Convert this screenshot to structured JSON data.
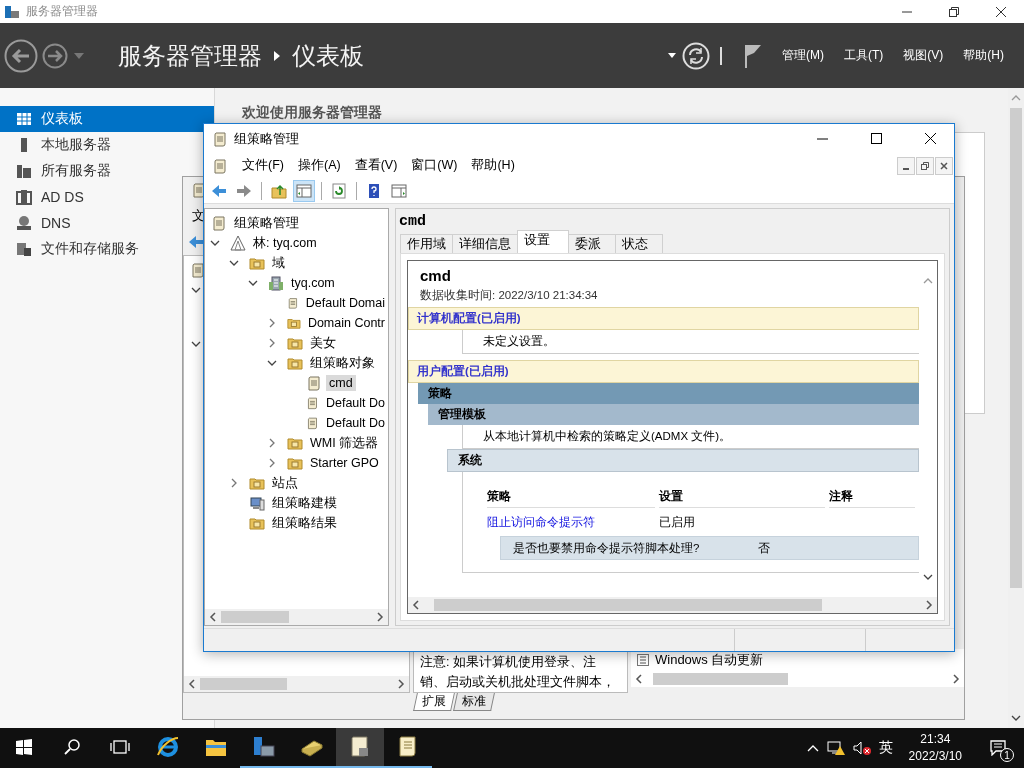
{
  "server_manager": {
    "title": "服务器管理器",
    "breadcrumb": {
      "app": "服务器管理器",
      "page": "仪表板"
    },
    "menu": [
      "管理(M)",
      "工具(T)",
      "视图(V)",
      "帮助(H)"
    ],
    "nav": [
      {
        "label": "仪表板",
        "kind": "dashboard",
        "selected": true
      },
      {
        "label": "本地服务器",
        "kind": "server",
        "selected": false
      },
      {
        "label": "所有服务器",
        "kind": "servers",
        "selected": false
      },
      {
        "label": "AD DS",
        "kind": "adds",
        "selected": false
      },
      {
        "label": "DNS",
        "kind": "dns",
        "selected": false
      },
      {
        "label": "文件和存储服务",
        "kind": "storage",
        "selected": false
      }
    ],
    "welcome": "欢迎使用服务器管理器"
  },
  "editor_window_behind": {
    "menu_visible": "文",
    "note_lines": [
      "注意: 如果计算机使用登录、注",
      "销、启动或关机批处理文件脚本，"
    ],
    "result_item": "Windows 自动更新",
    "tabs": [
      {
        "label": "扩展",
        "selected": true
      },
      {
        "label": "标准",
        "selected": false
      }
    ]
  },
  "gpm_window": {
    "title": "组策略管理",
    "menu": [
      "文件(F)",
      "操作(A)",
      "查看(V)",
      "窗口(W)",
      "帮助(H)"
    ],
    "tree": {
      "label": "组策略管理",
      "kind": "gpm",
      "selected": false,
      "children": [
        {
          "label": "林: tyq.com",
          "kind": "forest",
          "selected": false,
          "expanded": true,
          "children": [
            {
              "label": "域",
              "kind": "domains",
              "selected": false,
              "expanded": true,
              "children": [
                {
                  "label": "tyq.com",
                  "kind": "domain",
                  "selected": false,
                  "expanded": true,
                  "children": [
                    {
                      "label": "Default Domai",
                      "kind": "gpo-link",
                      "selected": false
                    },
                    {
                      "label": "Domain Contr",
                      "kind": "ou",
                      "selected": false,
                      "expanded": false
                    },
                    {
                      "label": "美女",
                      "kind": "ou",
                      "selected": false,
                      "expanded": false
                    },
                    {
                      "label": "组策略对象",
                      "kind": "gpo-folder",
                      "selected": false,
                      "expanded": true,
                      "children": [
                        {
                          "label": "cmd",
                          "kind": "gpo",
                          "selected": true
                        },
                        {
                          "label": "Default Do",
                          "kind": "gpo",
                          "selected": false
                        },
                        {
                          "label": "Default Do",
                          "kind": "gpo",
                          "selected": false
                        }
                      ]
                    },
                    {
                      "label": "WMI 筛选器",
                      "kind": "wmi-folder",
                      "selected": false,
                      "expanded": false
                    },
                    {
                      "label": "Starter GPO",
                      "kind": "starter-folder",
                      "selected": false,
                      "expanded": false
                    }
                  ]
                }
              ]
            },
            {
              "label": "站点",
              "kind": "sites",
              "selected": false,
              "expanded": false
            },
            {
              "label": "组策略建模",
              "kind": "modeling",
              "selected": false
            },
            {
              "label": "组策略结果",
              "kind": "results",
              "selected": false
            }
          ]
        }
      ]
    },
    "details": {
      "heading": "cmd",
      "tabs": [
        {
          "label": "作用域",
          "selected": false
        },
        {
          "label": "详细信息",
          "selected": false
        },
        {
          "label": "设置",
          "selected": true
        },
        {
          "label": "委派",
          "selected": false
        },
        {
          "label": "状态",
          "selected": false
        }
      ],
      "report": {
        "title": "cmd",
        "collected": "数据收集时间: 2022/3/10 21:34:34",
        "computer_config": {
          "heading": "计算机配置(已启用)",
          "note": "未定义设置。"
        },
        "user_config": {
          "heading": "用户配置(已启用)",
          "policies_heading": "策略",
          "templates_heading": "管理模板",
          "templates_note": "从本地计算机中检索的策略定义(ADMX 文件)。",
          "category": "系统",
          "columns": [
            "策略",
            "设置",
            "注释"
          ],
          "rows": [
            {
              "policy": "阻止访问命令提示符",
              "setting": "已启用",
              "option": {
                "question": "是否也要禁用命令提示符脚本处理?",
                "answer": "否"
              }
            }
          ]
        }
      }
    }
  },
  "taskbar": {
    "apps": [
      {
        "kind": "browser",
        "running": false,
        "active": false
      },
      {
        "kind": "explorer",
        "running": false,
        "active": false
      },
      {
        "kind": "server-manager",
        "running": true,
        "active": false
      },
      {
        "kind": "notebook",
        "running": true,
        "active": false
      },
      {
        "kind": "gpm",
        "running": true,
        "active": true
      },
      {
        "kind": "gpo-editor",
        "running": true,
        "active": false
      }
    ],
    "ime": "英",
    "time": "21:34",
    "date": "2022/3/10",
    "notifications": "1"
  }
}
